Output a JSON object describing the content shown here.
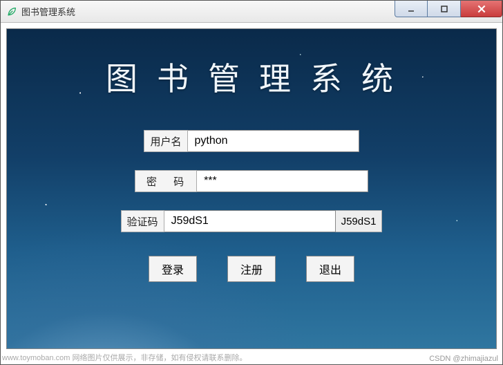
{
  "window": {
    "title": "图书管理系统"
  },
  "app_title": "图书管理系统",
  "form": {
    "username_label": "用户名",
    "username_value": "python",
    "password_label": "密 码",
    "password_value": "***",
    "captcha_label": "验证码",
    "captcha_value": "J59dS1",
    "captcha_display": "J59dS1"
  },
  "buttons": {
    "login": "登录",
    "register": "注册",
    "exit": "退出"
  },
  "footer": {
    "left": "www.toymoban.com 网络图片仅供展示，非存储，如有侵权请联系删除。",
    "right": "CSDN @zhimajiazul"
  }
}
